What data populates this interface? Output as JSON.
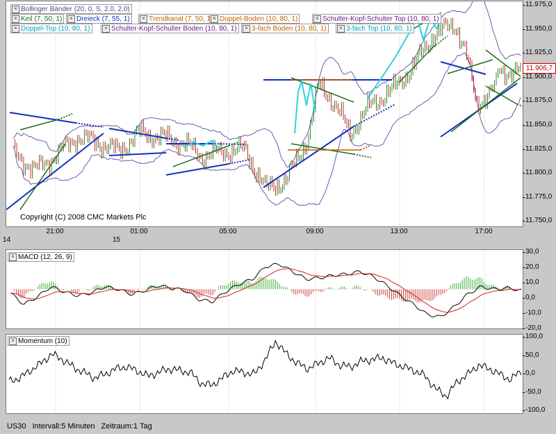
{
  "main": {
    "legend_rows": [
      [
        {
          "label": "Bollinger Bänder (20, 0, S, 2.0, 2.0)",
          "color": "#5a3d8c"
        }
      ],
      [
        {
          "label": "Keil (7, 50, 1)",
          "color": "#1f6b1f"
        },
        {
          "label": "Dreieck (7, 55, 1)",
          "color": "#1030c0"
        },
        {
          "label": "Trendkanal (7, 50, 1)",
          "color": "#c06000"
        },
        {
          "label": "Doppel-Boden (10, 80, 1)",
          "color": "#c06000"
        },
        {
          "label": "Schulter-Kopf-Schulter Top (10, 80, 1)",
          "color": "#6a1a8a"
        }
      ],
      [
        {
          "label": "Doppel-Top (10, 80, 1)",
          "color": "#00a0c0"
        },
        {
          "label": "Schulter-Kopf-Schulter Boden (10, 80, 1)",
          "color": "#6a1a8a"
        },
        {
          "label": "3-fach Boden (10, 80, 1)",
          "color": "#c06000"
        },
        {
          "label": "3-fach Top (10, 80, 1)",
          "color": "#00a0c0"
        }
      ]
    ],
    "y_ticks": [
      "11.975,0",
      "11.950,0",
      "11.925,0",
      "11.900,0",
      "11.875,0",
      "11.850,0",
      "11.825,0",
      "11.800,0",
      "11.775,0",
      "11.750,0"
    ],
    "x_ticks": [
      "21:00",
      "01:00",
      "05:00",
      "09:00",
      "13:00",
      "17:00"
    ],
    "day_labels": [
      "14",
      "15"
    ],
    "current_price": "11.906,7",
    "copyright": "Copyright (C) 2008 CMC Markets Plc"
  },
  "macd": {
    "legend": "MACD (12, 26, 9)",
    "y_ticks": [
      "30,0",
      "20,0",
      "10,0",
      "0,0",
      "-10,0",
      "-20,0"
    ]
  },
  "momentum": {
    "legend": "Momentum (10)",
    "y_ticks": [
      "100,0",
      "50,0",
      "0,0",
      "-50,0",
      "-100,0"
    ]
  },
  "footer": {
    "symbol": "US30",
    "interval": "Intervall:5 Minuten",
    "range": "Zeitraum:1 Tag"
  },
  "chart_data": [
    {
      "type": "line",
      "title": "US30",
      "subtitle": "Intervall:5 Minuten  Zeitraum:1 Tag",
      "ylim": [
        11750,
        11975
      ],
      "x_ticks": [
        "21:00",
        "01:00",
        "05:00",
        "09:00",
        "13:00",
        "17:00"
      ],
      "series": [
        {
          "name": "Bollinger Bänder (20, 0, S, 2.0, 2.0)",
          "x_hours": [
            18,
            19,
            20,
            21,
            22,
            23,
            0,
            1,
            2,
            3,
            4,
            5,
            6,
            7,
            8,
            8.5,
            9,
            10,
            11,
            12,
            13,
            14,
            15,
            15.5,
            16,
            17,
            18
          ],
          "values": [
            11820,
            11800,
            11815,
            11835,
            11830,
            11820,
            11840,
            11835,
            11830,
            11815,
            11820,
            11822,
            11780,
            11790,
            11835,
            11890,
            11880,
            11840,
            11870,
            11885,
            11910,
            11945,
            11955,
            11925,
            11870,
            11890,
            11905
          ]
        }
      ],
      "last_value": 11906.7
    },
    {
      "type": "line",
      "title": "MACD (12, 26, 9)",
      "ylim": [
        -25,
        30
      ],
      "series": [
        {
          "name": "MACD",
          "values": [
            -3,
            -12,
            -6,
            2,
            -2,
            -5,
            -3,
            2,
            0,
            -4,
            -1,
            3,
            1,
            -1,
            -8,
            -10,
            -2,
            4,
            8,
            18,
            20,
            14,
            8,
            9,
            11,
            12,
            14,
            10,
            3,
            -5,
            -12,
            -20,
            -22,
            -14,
            -4,
            2,
            0,
            1,
            -1
          ]
        }
      ]
    },
    {
      "type": "line",
      "title": "Momentum (10)",
      "ylim": [
        -100,
        100
      ],
      "series": [
        {
          "name": "Momentum",
          "values": [
            -20,
            -10,
            10,
            30,
            55,
            40,
            20,
            5,
            -10,
            0,
            15,
            20,
            10,
            -5,
            5,
            15,
            10,
            5,
            -25,
            -30,
            -10,
            10,
            5,
            0,
            40,
            90,
            55,
            30,
            15,
            30,
            45,
            25,
            20,
            35,
            40,
            45,
            30,
            20,
            10,
            -5,
            -40,
            -60,
            -20,
            0,
            25,
            15,
            0,
            -15,
            10
          ]
        }
      ]
    }
  ]
}
